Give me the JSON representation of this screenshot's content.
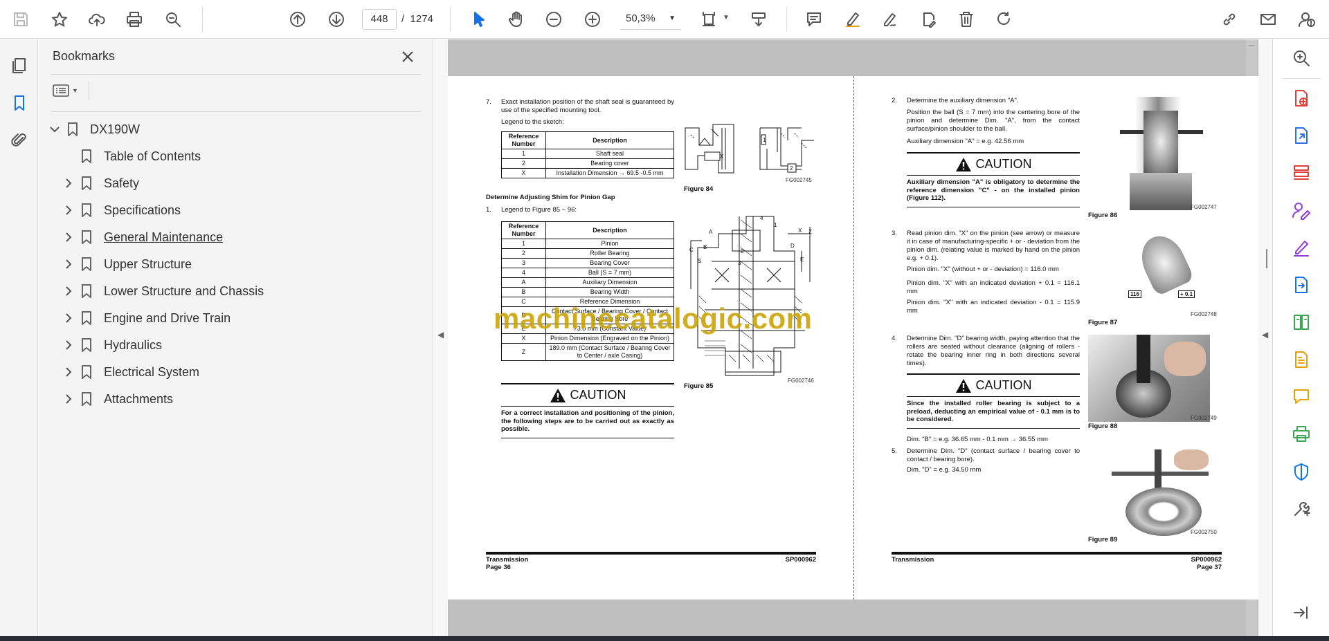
{
  "toolbar": {
    "page_current": "448",
    "page_separator": "/",
    "page_total": "1274",
    "zoom": "50,3%"
  },
  "bookmarks_panel": {
    "title": "Bookmarks",
    "root": "DX190W",
    "items": [
      {
        "label": "Table of Contents",
        "expandable": false
      },
      {
        "label": "Safety",
        "expandable": true
      },
      {
        "label": "Specifications",
        "expandable": true
      },
      {
        "label": "General Maintenance",
        "expandable": true
      },
      {
        "label": "Upper Structure",
        "expandable": true
      },
      {
        "label": "Lower Structure and Chassis",
        "expandable": true
      },
      {
        "label": "Engine and Drive Train",
        "expandable": true
      },
      {
        "label": "Hydraulics",
        "expandable": true
      },
      {
        "label": "Electrical System",
        "expandable": true
      },
      {
        "label": "Attachments",
        "expandable": true
      }
    ]
  },
  "watermark": "machinecatalogic.com",
  "left_page": {
    "step7_num": "7.",
    "step7_text": "Exact installation position of the shaft seal is guaranteed by use of the specified mounting tool.",
    "legend_label": "Legend to the sketch:",
    "table1_header": [
      "Reference Number",
      "Description"
    ],
    "table1_rows": [
      [
        "1",
        "Shaft seal"
      ],
      [
        "2",
        "Bearing cover"
      ],
      [
        "X",
        "Installation Dimension → 69.5 -0.5 mm"
      ]
    ],
    "fig84": "Figure 84",
    "fig84_code": "FG002745",
    "section_title": "Determine Adjusting Shim for Pinion Gap",
    "step1_num": "1.",
    "step1_text": "Legend to Figure 85 ~ 96:",
    "table2_header": [
      "Reference Number",
      "Description"
    ],
    "table2_rows": [
      [
        "1",
        "Pinion"
      ],
      [
        "2",
        "Roller Bearing"
      ],
      [
        "3",
        "Bearing Cover"
      ],
      [
        "4",
        "Ball (S = 7 mm)"
      ],
      [
        "A",
        "Auxiliary Dimension"
      ],
      [
        "B",
        "Bearing Width"
      ],
      [
        "C",
        "Reference Dimension"
      ],
      [
        "D",
        "Contact Surface / Bearing Cover / Contact Bearing Bore"
      ],
      [
        "E",
        "73.0 mm (Constant Value)"
      ],
      [
        "X",
        "Pinion Dimension (Engraved on the Pinion)"
      ],
      [
        "Z",
        "189.0 mm (Contact Surface / Bearing Cover to Center / axle Casing)"
      ]
    ],
    "fig85": "Figure 85",
    "fig85_code": "FG002746",
    "caution_title": "CAUTION",
    "caution_text": "For a correct installation and positioning of the pinion, the following steps are to be carried out as exactly as possible.",
    "footer_left": "Transmission",
    "footer_page": "Page 36",
    "footer_code": "SP000962"
  },
  "right_page": {
    "s2_num": "2.",
    "s2_title": "Determine the auxiliary dimension \"A\".",
    "s2_text": "Position the ball (S = 7 mm) into the centering bore of the pinion and determine Dim. \"A\", from the contact surface/pinion shoulder to the ball.",
    "s2_aux": "Auxiliary dimension \"A\" = e.g. 42.56 mm",
    "caution1_title": "CAUTION",
    "caution1_text": "Auxiliary dimension \"A\" is obligatory to determine the reference dimension \"C\" - on the installed pinion (Figure 112).",
    "s3_num": "3.",
    "s3_text": "Read pinion dim. \"X\" on the pinion (see arrow) or measure it in case of manufacturing-specific + or - deviation from the pinion dim. (relating value is marked by hand on the pinion e.g. + 0.1).",
    "s3_l1": "Pinion dim. \"X\" (without + or - deviation)  = 116.0 mm",
    "s3_l2": "Pinion dim. \"X\" with an indicated deviation + 0.1 = 116.1 mm",
    "s3_l3": "Pinion dim. \"X\" with an indicated deviation - 0.1 = 115.9 mm",
    "s4_num": "4.",
    "s4_text": "Determine Dim. \"D\" bearing width, paying attention that the rollers are seated without clearance (aligning of rollers - rotate the bearing inner ring in both directions several times).",
    "caution2_title": "CAUTION",
    "caution2_text": "Since the installed roller bearing is subject to a preload, deducting an empirical value of - 0.1 mm is to be considered.",
    "s4_dim": "Dim. \"B\" = e.g. 36.65 mm - 0.1 mm → 36.55 mm",
    "s5_num": "5.",
    "s5_text": "Determine Dim. \"D\" (contact surface / bearing cover to contact / bearing bore).",
    "s5_dim": "Dim. \"D\" = e.g. 34.50 mm",
    "fig86": "Figure 86",
    "fig86_code": "FG002747",
    "fig87": "Figure 87",
    "fig87_code": "FG002748",
    "fig88": "Figure 88",
    "fig88_code": "FG002749",
    "fig89": "Figure 89",
    "fig89_code": "FG002750",
    "tag116": "116",
    "tag01": "+ 0.1",
    "footer_left": "Transmission",
    "footer_page": "Page 37",
    "footer_code": "SP000962"
  }
}
